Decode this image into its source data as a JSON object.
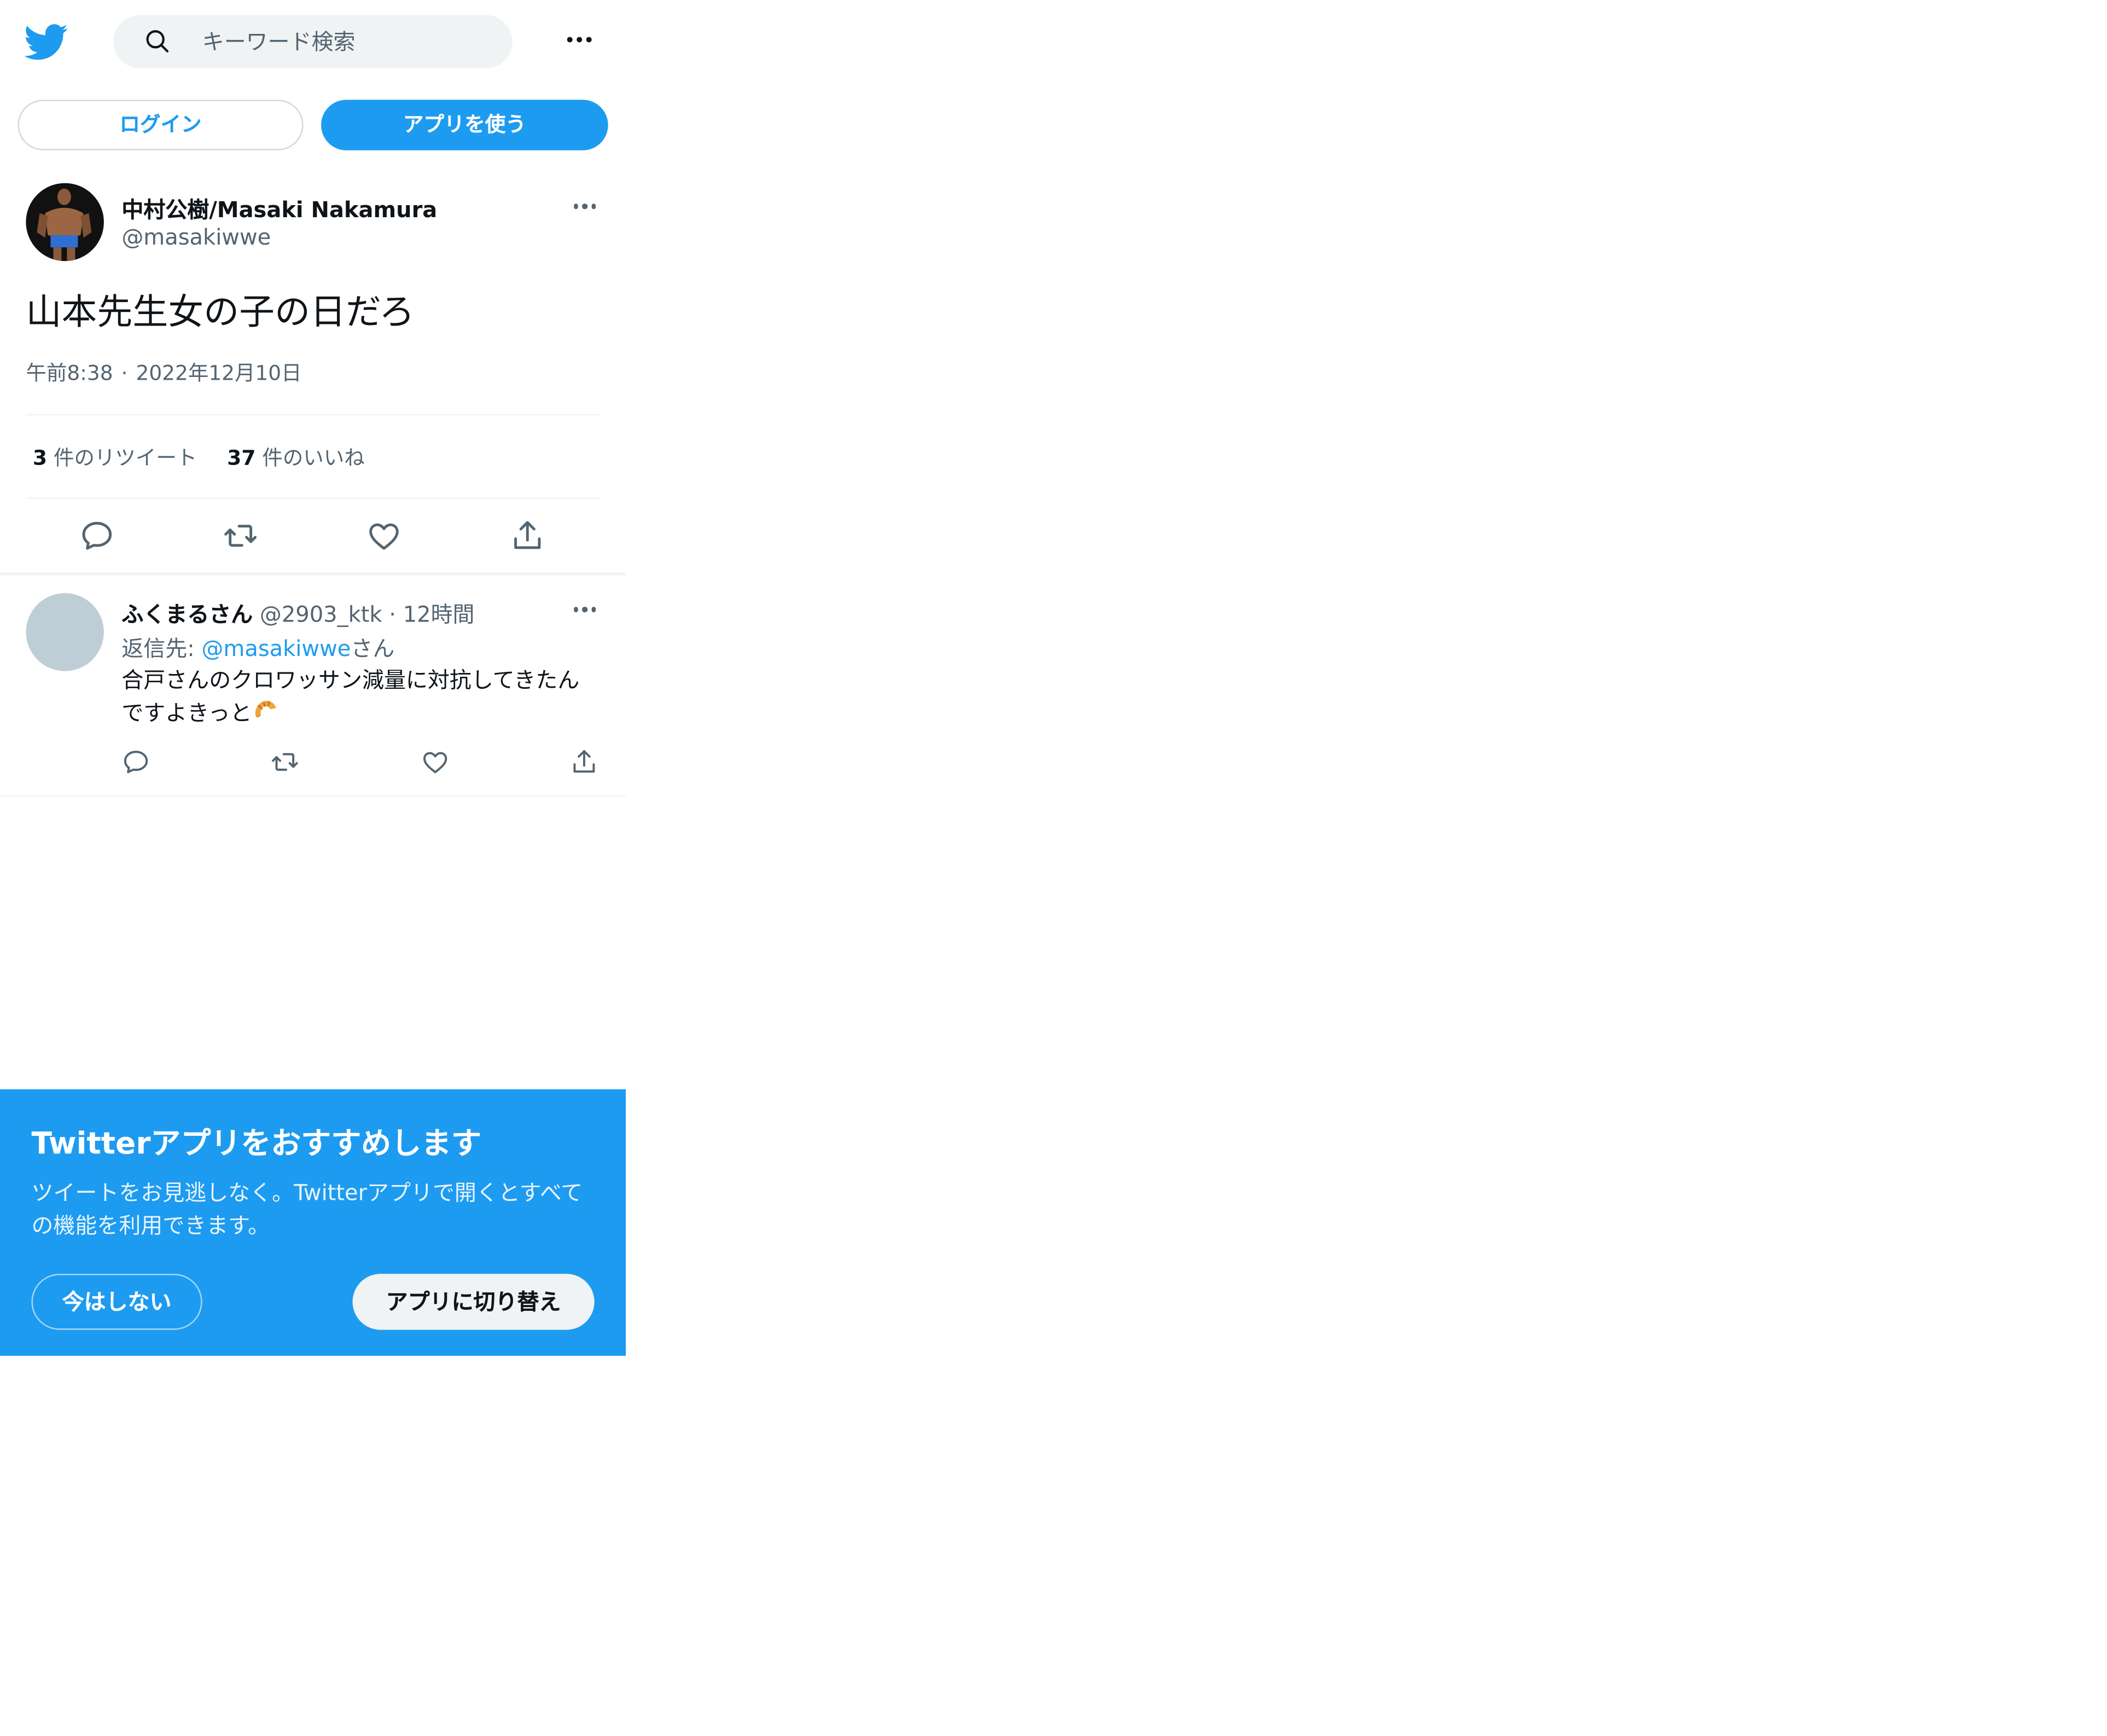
{
  "header": {
    "search_placeholder": "キーワード検索"
  },
  "auth": {
    "login_label": "ログイン",
    "use_app_label": "アプリを使う"
  },
  "tweet": {
    "author_name": "中村公樹/Masaki Nakamura",
    "author_handle": "@masakiwwe",
    "text": "山本先生女の子の日だろ",
    "time": "午前8:38",
    "date": "2022年12月10日",
    "retweet_count": "3",
    "retweet_label": "件のリツイート",
    "like_count": "37",
    "like_label": "件のいいね"
  },
  "reply": {
    "name": "ふくまるさん",
    "handle": "@2903_ktk",
    "time": "12時間",
    "reply_to_prefix": "返信先: ",
    "reply_to_mention": "@masakiwwe",
    "reply_to_suffix": "さん",
    "text": "合戸さんのクロワッサン減量に対抗してきたんですよきっと"
  },
  "banner": {
    "title": "Twitterアプリをおすすめします",
    "body": "ツイートをお見逃しなく。Twitterアプリで開くとすべての機能を利用できます。",
    "not_now_label": "今はしない",
    "switch_label": "アプリに切り替え"
  },
  "colors": {
    "brand": "#1d9bf0",
    "text_primary": "#0f1419",
    "text_secondary": "#536471",
    "search_bg": "#eff3f4"
  },
  "icons": [
    "twitter-bird-icon",
    "search-icon",
    "more-icon",
    "reply-icon",
    "retweet-icon",
    "like-icon",
    "share-icon",
    "croissant-emoji"
  ]
}
